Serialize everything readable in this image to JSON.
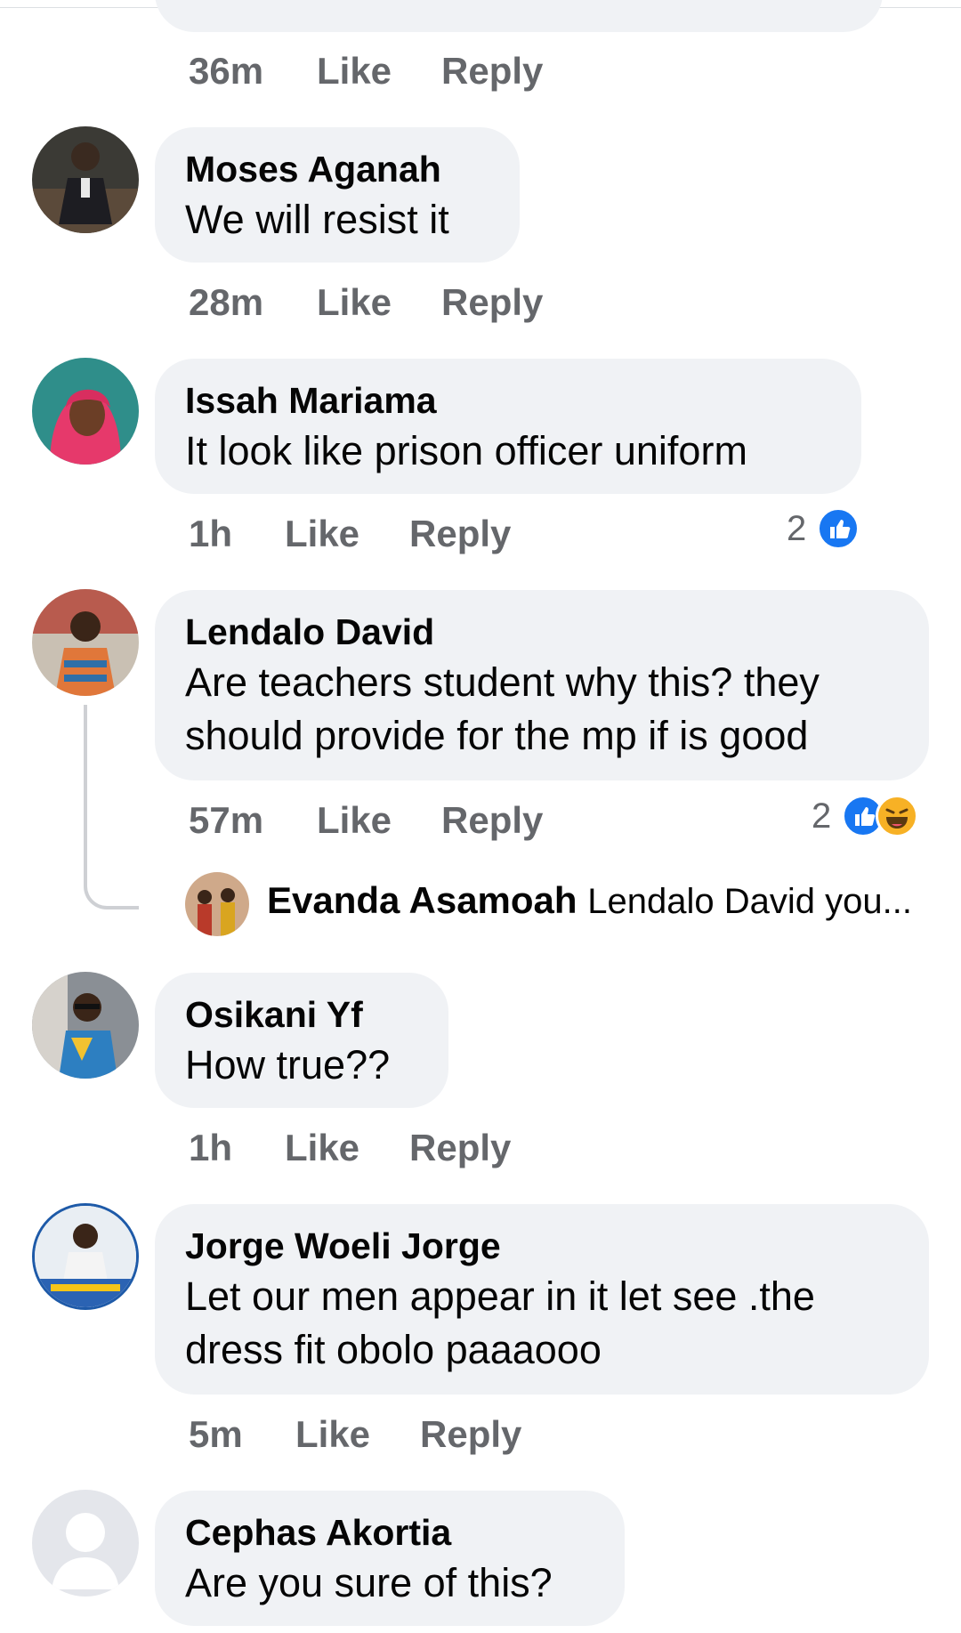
{
  "comments": [
    {
      "name": "",
      "text": "",
      "time": "36m",
      "like": "Like",
      "reply": "Reply"
    },
    {
      "name": "Moses Aganah",
      "text": "We will resist it",
      "time": "28m",
      "like": "Like",
      "reply": "Reply"
    },
    {
      "name": "Issah Mariama",
      "text": "It look like prison officer uniform",
      "time": "1h",
      "like": "Like",
      "reply": "Reply",
      "reaction_count": "2"
    },
    {
      "name": "Lendalo David",
      "text": "Are teachers student why this? they should provide for the mp if is good",
      "time": "57m",
      "like": "Like",
      "reply": "Reply",
      "reaction_count": "2"
    },
    {
      "name": "Osikani Yf",
      "text": "How true??",
      "time": "1h",
      "like": "Like",
      "reply": "Reply"
    },
    {
      "name": "Jorge Woeli Jorge",
      "text": "Let our men appear in it let see .the dress fit obolo paaaooo",
      "time": "5m",
      "like": "Like",
      "reply": "Reply"
    },
    {
      "name": "Cephas Akortia",
      "text": "Are you sure of this?"
    }
  ],
  "reply_preview": {
    "name": "Evanda Asamoah",
    "text": "Lendalo David you..."
  },
  "icons": {
    "like": "like-reaction-icon",
    "haha": "haha-reaction-icon",
    "default_avatar": "default-avatar-icon"
  },
  "colors": {
    "bubble": "#f0f2f5",
    "meta": "#65676b",
    "like_blue": "#1877f2",
    "haha_yellow": "#f7b125"
  }
}
